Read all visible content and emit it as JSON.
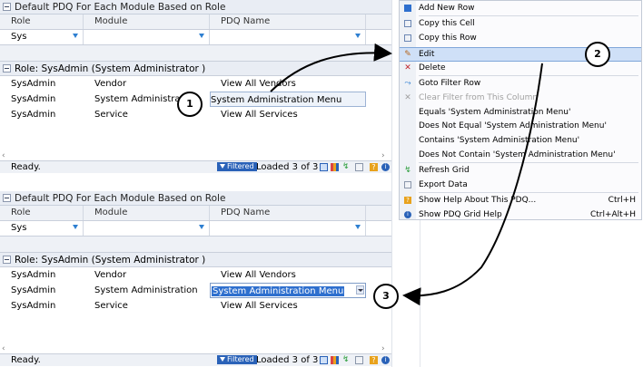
{
  "grids": [
    {
      "title": "Default PDQ For Each Module Based on Role",
      "columns": [
        "Role",
        "Module",
        "PDQ Name"
      ],
      "filter_values": [
        "Sys",
        "",
        ""
      ],
      "group_label": "Role: SysAdmin (System Administrator )",
      "rows": [
        [
          "SysAdmin",
          "Vendor",
          "View All Vendors"
        ],
        [
          "SysAdmin",
          "System Administration",
          "System Administration Menu"
        ],
        [
          "SysAdmin",
          "Service",
          "View All Services"
        ]
      ],
      "status_text": "Ready.",
      "filtered_badge": "Filtered",
      "loaded_text": "Loaded 3 of 3"
    },
    {
      "title": "Default PDQ For Each Module Based on Role",
      "columns": [
        "Role",
        "Module",
        "PDQ Name"
      ],
      "filter_values": [
        "Sys",
        "",
        ""
      ],
      "group_label": "Role: SysAdmin (System Administrator )",
      "rows": [
        [
          "SysAdmin",
          "Vendor",
          "View All Vendors"
        ],
        [
          "SysAdmin",
          "System Administration",
          "System Administration Menu"
        ],
        [
          "SysAdmin",
          "Service",
          "View All Services"
        ]
      ],
      "status_text": "Ready.",
      "filtered_badge": "Filtered",
      "loaded_text": "Loaded 3 of 3"
    }
  ],
  "context_menu": {
    "items": [
      {
        "label": "Add New Row",
        "icon": "add-row-icon",
        "shortcut": ""
      },
      {
        "label": "Copy this Cell",
        "icon": "copy-cell-icon",
        "shortcut": ""
      },
      {
        "label": "Copy this Row",
        "icon": "copy-row-icon",
        "shortcut": ""
      },
      {
        "label": "Edit",
        "icon": "pencil-icon",
        "shortcut": ""
      },
      {
        "label": "Delete",
        "icon": "delete-icon",
        "shortcut": ""
      },
      {
        "label": "Goto Filter Row",
        "icon": "filter-row-icon",
        "shortcut": ""
      },
      {
        "label": "Clear Filter from This Column",
        "icon": "clear-filter-icon",
        "shortcut": ""
      },
      {
        "label": "Equals 'System Administration Menu'",
        "icon": "",
        "shortcut": ""
      },
      {
        "label": "Does Not Equal 'System Administration Menu'",
        "icon": "",
        "shortcut": ""
      },
      {
        "label": "Contains 'System Administration Menu'",
        "icon": "",
        "shortcut": ""
      },
      {
        "label": "Does Not Contain 'System Administration Menu'",
        "icon": "",
        "shortcut": ""
      },
      {
        "label": "Refresh Grid",
        "icon": "refresh-icon",
        "shortcut": ""
      },
      {
        "label": "Export Data",
        "icon": "export-icon",
        "shortcut": ""
      },
      {
        "label": "Show Help About This PDQ...",
        "icon": "help-icon",
        "shortcut": "Ctrl+H"
      },
      {
        "label": "Show PDQ Grid Help",
        "icon": "info-icon",
        "shortcut": "Ctrl+Alt+H"
      }
    ]
  },
  "callouts": [
    "1",
    "2",
    "3"
  ],
  "colors": {
    "selection": "#2e6fce",
    "menu_highlight": "#cfe0f7",
    "filtered_badge": "#2a62b8",
    "filter_icon": "#2e7fd1"
  }
}
